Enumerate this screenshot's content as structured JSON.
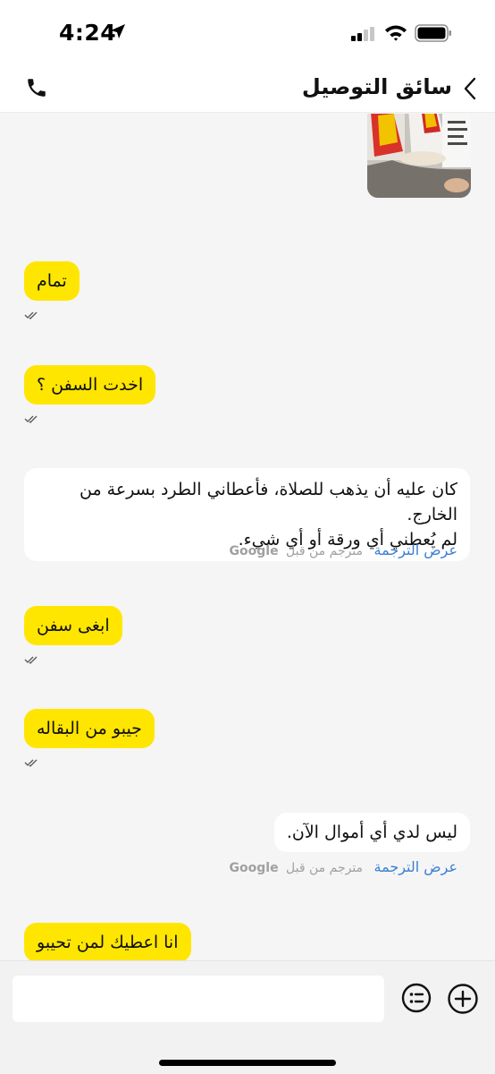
{
  "status_bar": {
    "time": "4:24"
  },
  "header": {
    "title": "سائق التوصيل"
  },
  "messages": {
    "m1": "تمام",
    "m2": "اخدت السفن ؟",
    "m3_line1": "كان عليه أن يذهب للصلاة، فأعطاني الطرد بسرعة من الخارج.",
    "m3_line2": "لم يُعطني أي ورقة أو أي شيء.",
    "m4": "ابغى سفن",
    "m5": "جيبو من البقاله",
    "m6": "ليس لدي أي أموال الآن.",
    "m7": "انا اعطيك لمن تحيبو"
  },
  "translation": {
    "link": "عرض الترجمة",
    "by": "مترجم من قبل",
    "provider": "Google"
  },
  "input": {
    "placeholder": ""
  },
  "colors": {
    "outgoing": "#ffe600",
    "incoming": "#ffffff",
    "link": "#3b7fd4"
  }
}
